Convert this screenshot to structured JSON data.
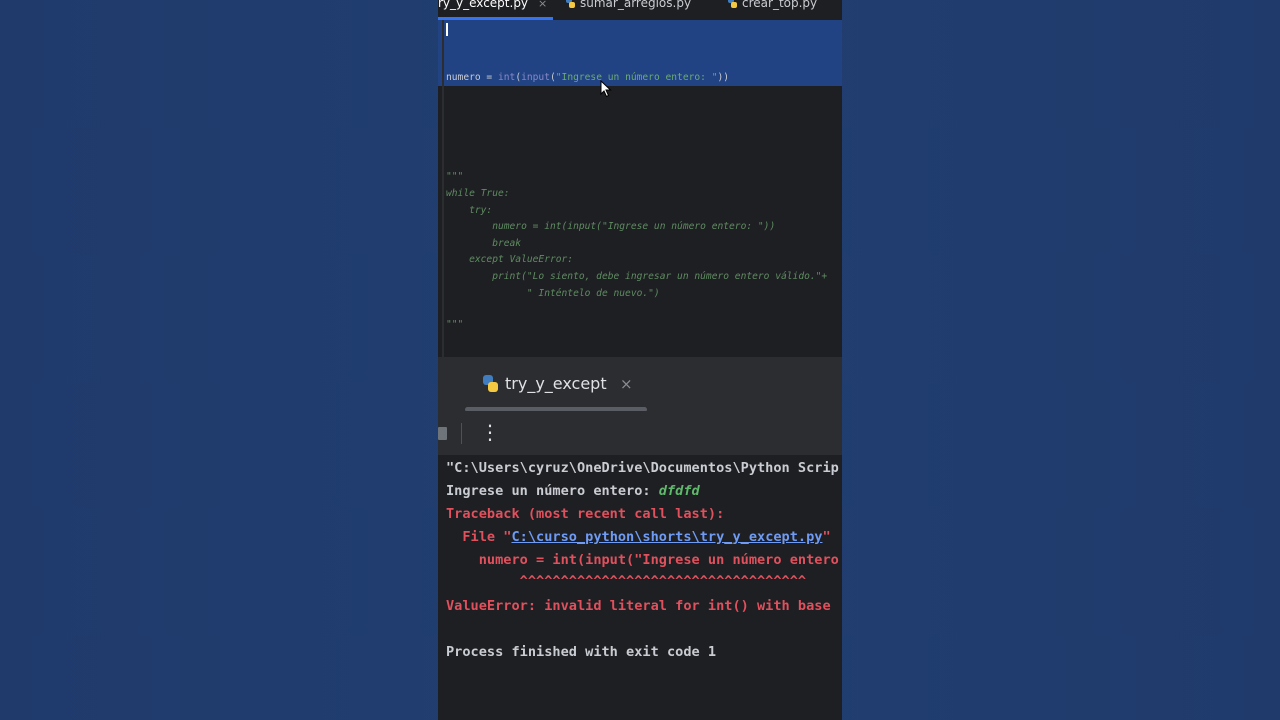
{
  "tabs": [
    {
      "label": "ry_y_except.py",
      "close": "×",
      "active": true
    },
    {
      "label": "sumar_arreglos.py",
      "active": false
    },
    {
      "label": "crear_top.py",
      "active": false
    }
  ],
  "editor": {
    "selected_line": {
      "var": "numero",
      "op": " = ",
      "fn1": "int",
      "p1": "(",
      "fn2": "input",
      "p2": "(",
      "str": "\"Ingrese un número entero: \"",
      "end": "))"
    },
    "docstring": [
      "\"\"\"",
      "while True:",
      "    try:",
      "        numero = int(input(\"Ingrese un número entero: \"))",
      "        break",
      "    except ValueError:",
      "        print(\"Lo siento, debe ingresar un número entero válido.\"+",
      "              \" Inténtelo de nuevo.\")",
      "\"\"\""
    ]
  },
  "run_panel": {
    "tab_label": "try_y_except",
    "close": "×",
    "more_icon": "⋮"
  },
  "console": {
    "cmd": "\"C:\\Users\\cyruz\\OneDrive\\Documentos\\Python Scrip",
    "prompt": "Ingrese un número entero: ",
    "user_input": "dfdfd",
    "traceback": "Traceback (most recent call last):",
    "file_prefix": "  File \"",
    "file_link": "C:\\curso_python\\shorts\\try_y_except.py",
    "file_suffix": "\"",
    "code_line": "    numero = int(input(\"Ingrese un número entero",
    "carets": "         ^^^^^^^^^^^^^^^^^^^^^^^^^^^^^^^^^^^",
    "error": "ValueError: invalid literal for int() with base",
    "finished": "Process finished with exit code 1"
  },
  "colors": {
    "accent": "#3574f0",
    "error": "#e0505d",
    "input": "#5fb86b",
    "link": "#6f9bf5",
    "selection": "#214283"
  }
}
